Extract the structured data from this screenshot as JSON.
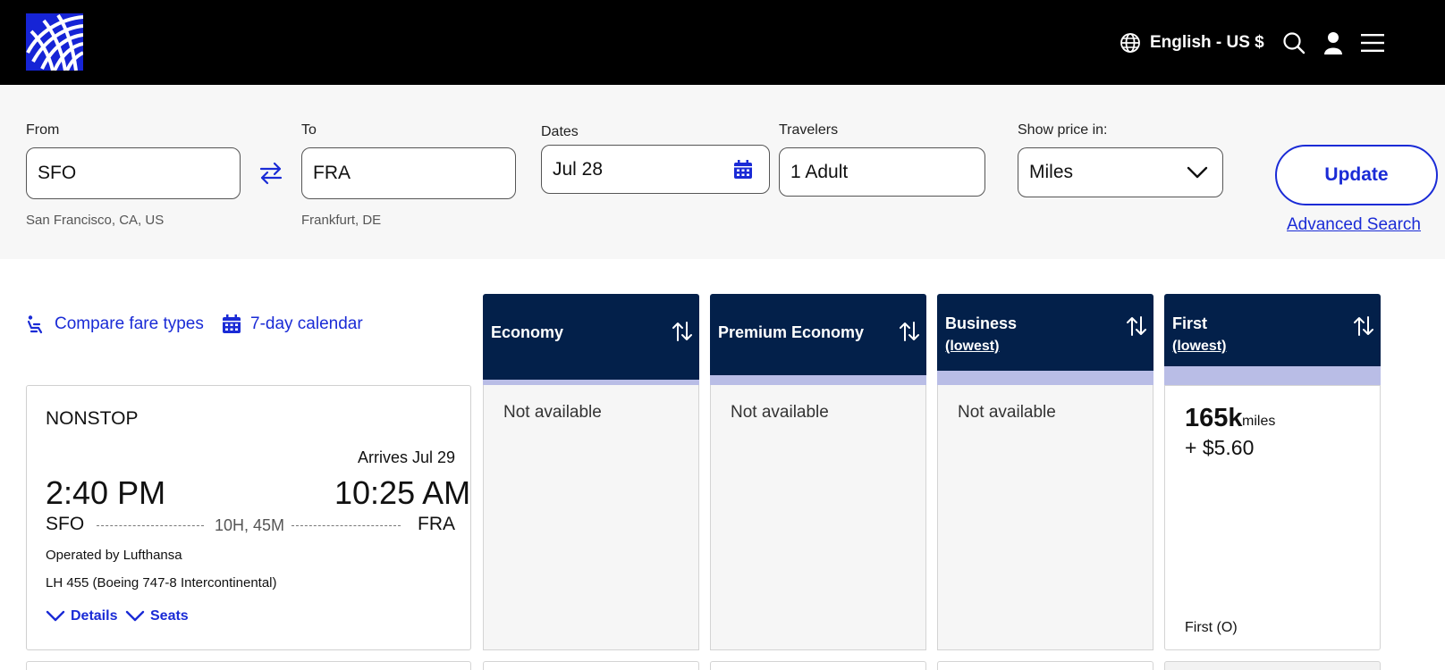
{
  "header": {
    "language": "English - US $",
    "icons": [
      "globe-icon",
      "search-icon",
      "user-icon",
      "menu-icon"
    ]
  },
  "search": {
    "from_label": "From",
    "from_value": "SFO",
    "from_sub": "San Francisco, CA, US",
    "to_label": "To",
    "to_value": "FRA",
    "to_sub": "Frankfurt, DE",
    "dates_label": "Dates",
    "dates_value": "Jul 28",
    "travelers_label": "Travelers",
    "travelers_value": "1 Adult",
    "price_label": "Show price in:",
    "price_value": "Miles",
    "update_label": "Update",
    "advanced_label": "Advanced Search"
  },
  "tools": {
    "compare_label": "Compare fare types",
    "calendar_label": "7-day calendar"
  },
  "fare_columns": [
    {
      "title": "Economy",
      "sub": ""
    },
    {
      "title": "Premium Economy",
      "sub": ""
    },
    {
      "title": "Business",
      "sub": "(lowest)"
    },
    {
      "title": "First",
      "sub": "(lowest)"
    }
  ],
  "flight": {
    "stops": "NONSTOP",
    "arrives": "Arrives Jul 29",
    "depart_time": "2:40 PM",
    "arrive_time": "10:25 AM",
    "origin": "SFO",
    "destination": "FRA",
    "duration": "10H, 45M",
    "operated_by": "Operated by Lufthansa",
    "aircraft": "LH 455 (Boeing 747-8 Intercontinental)",
    "details_label": "Details",
    "seats_label": "Seats"
  },
  "fares": {
    "economy": "Not available",
    "premium": "Not available",
    "business": "Not available",
    "first_miles": "165k",
    "first_unit": "miles",
    "first_cash": "+ $5.60",
    "first_code": "First (O)"
  },
  "colors": {
    "brand_blue": "#1a2bd6",
    "header_navy": "#03204a",
    "strip_lavender": "#b9bde6"
  }
}
